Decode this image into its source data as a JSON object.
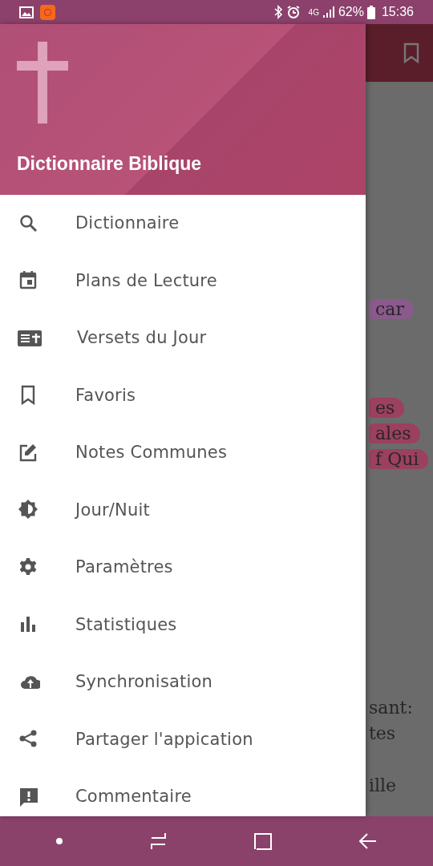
{
  "status_bar": {
    "network": "4G",
    "battery": "62%",
    "time": "15:36"
  },
  "drawer": {
    "title": "Dictionnaire Biblique",
    "items": [
      {
        "kind": "search",
        "label": "Dictionnaire"
      },
      {
        "kind": "calendar",
        "label": "Plans de Lecture"
      },
      {
        "kind": "verse",
        "label": "Versets du Jour"
      },
      {
        "kind": "bookmark",
        "label": "Favoris"
      },
      {
        "kind": "edit",
        "label": "Notes Communes"
      },
      {
        "kind": "brightness",
        "label": "Jour/Nuit"
      },
      {
        "kind": "settings",
        "label": "Paramètres"
      },
      {
        "kind": "stats",
        "label": "Statistiques"
      },
      {
        "kind": "cloud",
        "label": "Synchronisation"
      },
      {
        "kind": "share",
        "label": "Partager l'appication"
      },
      {
        "kind": "feedback",
        "label": "Commentaire"
      }
    ]
  },
  "background": {
    "lines": [
      {
        "text": "car",
        "highlighted": true,
        "color": "#8a5a8c"
      },
      {
        "text": "es",
        "highlighted": true,
        "color": "#9c4060"
      },
      {
        "text": "ales",
        "highlighted": true,
        "color": "#9c4060"
      },
      {
        "text": "f Qui",
        "highlighted": true,
        "color": "#9c4060"
      },
      {
        "text": "sant:",
        "highlighted": false
      },
      {
        "text": "tes",
        "highlighted": false
      },
      {
        "text": "ille",
        "highlighted": false
      }
    ]
  }
}
